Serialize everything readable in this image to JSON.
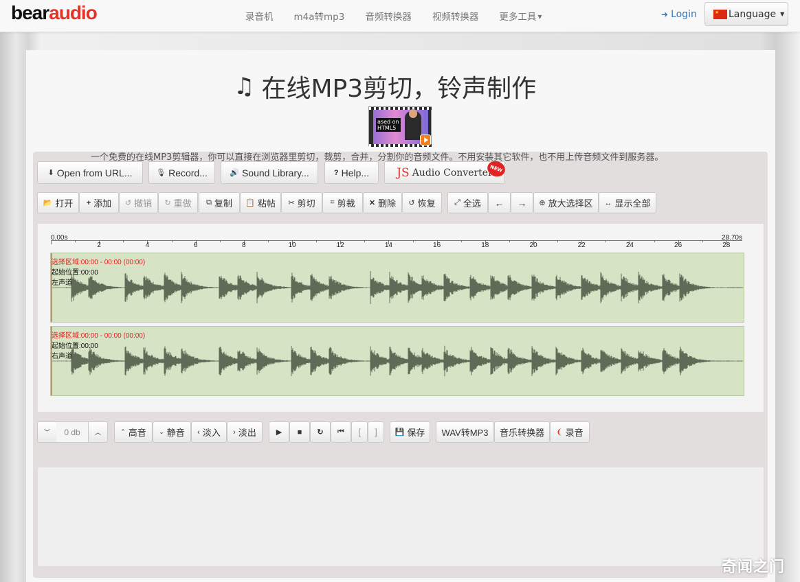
{
  "navbar": {
    "logo_part1": "bear",
    "logo_part2": "audio",
    "links": [
      "录音机",
      "m4a转mp3",
      "音频转换器",
      "视频转换器",
      "更多工具"
    ],
    "login": "Login",
    "language": "Language"
  },
  "hero": {
    "title": "在线MP3剪切，铃声制作",
    "video_text": "ased on\nHTML5",
    "subtitle": "一个免费的在线MP3剪辑器，你可以直接在浏览器里剪切，裁剪，合并，分割你的音频文件。不用安装其它软件，也不用上传音频文件到服务器。"
  },
  "top_buttons": {
    "open_url": "Open from URL...",
    "record": "Record...",
    "sound_library": "Sound Library...",
    "help": "Help...",
    "converter_js": "JS",
    "converter_text": "Audio Converter",
    "new_badge": "NEW"
  },
  "toolbar": {
    "open": "打开",
    "add": "添加",
    "undo": "撤销",
    "redo": "重做",
    "copy": "复制",
    "paste": "粘帖",
    "cut": "剪切",
    "crop": "剪裁",
    "delete": "删除",
    "restore": "恢复",
    "select_all": "全选",
    "zoom_selection": "放大选择区",
    "show_all": "显示全部"
  },
  "timeline": {
    "start": "0.00s",
    "end": "28.70s",
    "ticks": [
      "2",
      "4",
      "6",
      "8",
      "10",
      "12",
      "14",
      "16",
      "18",
      "20",
      "22",
      "24",
      "26",
      "28"
    ]
  },
  "tracks": [
    {
      "selection": "选择区域:00:00 - 00:00 (00:00)",
      "position": "起始位置:00:00",
      "channel": "左声道"
    },
    {
      "selection": "选择区域:00:00 - 00:00 (00:00)",
      "position": "起始位置:00:00",
      "channel": "右声道"
    }
  ],
  "bottom": {
    "db_value": "0 db",
    "louder": "高音",
    "mute": "静音",
    "fade_in": "淡入",
    "fade_out": "淡出",
    "bracket_left": "[",
    "bracket_right": "]",
    "save": "保存",
    "wav_to_mp3": "WAV转MP3",
    "music_converter": "音乐转换器",
    "record": "录音"
  },
  "watermark": "奇闻之门",
  "colors": {
    "accent_red": "#e5332a",
    "link_blue": "#337ab7",
    "track_bg": "#d7e3c5",
    "wave": "#5f6b57",
    "selection_text": "#e0211c"
  }
}
